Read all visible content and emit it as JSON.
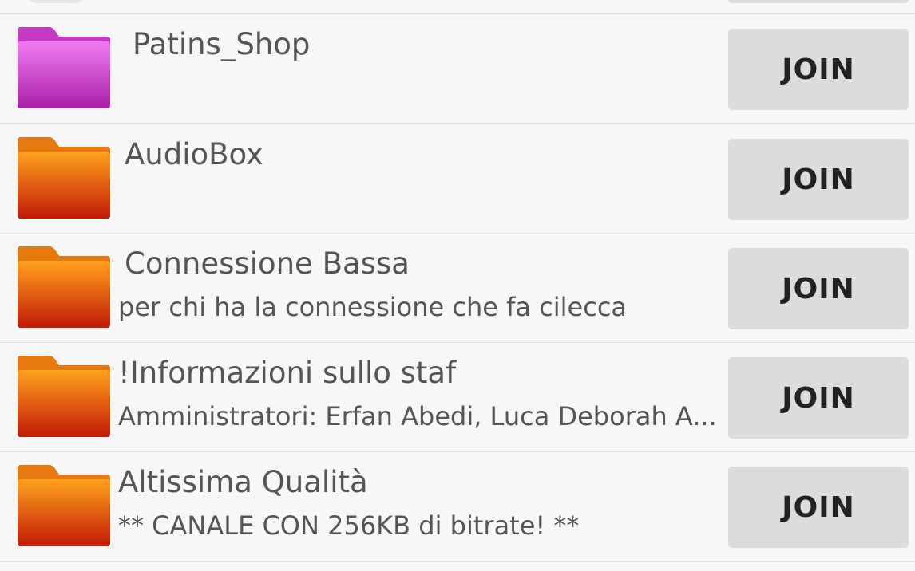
{
  "channels": [
    {
      "name": "Patins_Shop",
      "description": "",
      "folder_color": "magenta",
      "join_label": "JOIN"
    },
    {
      "name": "AudioBox",
      "description": "",
      "folder_color": "orange",
      "join_label": "JOIN"
    },
    {
      "name": "Connessione Bassa",
      "description": "per chi ha la connessione che fa cilecca",
      "folder_color": "orange",
      "join_label": "JOIN"
    },
    {
      "name": "!Informazioni sullo staf",
      "description": "Amministratori: Erfan Abedi, Luca Deborah A...",
      "folder_color": "orange",
      "join_label": "JOIN"
    },
    {
      "name": "Altissima Qualità",
      "description": "** CANALE CON 256KB di bitrate! **",
      "folder_color": "orange",
      "join_label": "JOIN"
    }
  ],
  "colors": {
    "magenta_top": "#f07cf0",
    "magenta_bottom": "#a81fa8",
    "orange_top": "#ffa21e",
    "orange_bottom": "#c11a06",
    "button_bg": "#dcdcdc"
  }
}
